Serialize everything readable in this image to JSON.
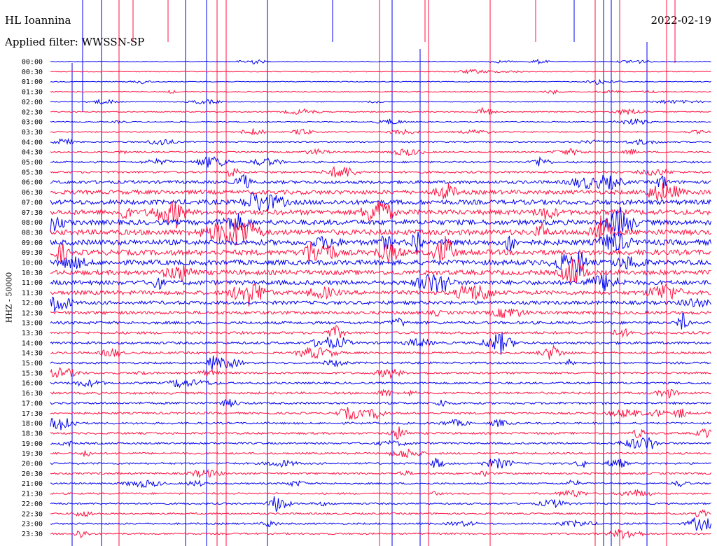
{
  "header": {
    "station": "HL Ioannina",
    "filter": "Applied filter: WWSSN-SP",
    "date": "2022-02-19"
  },
  "colors": {
    "trace_a": "#0000ee",
    "trace_b": "#ff1040"
  },
  "chart_data": {
    "type": "line",
    "title": "HL Ioannina",
    "subtitle": "Applied filter: WWSSN-SP",
    "ylabel": "HHZ - 50000",
    "y_ticks": [
      "00:00",
      "00:30",
      "01:00",
      "01:30",
      "02:00",
      "02:30",
      "03:00",
      "03:30",
      "04:00",
      "04:30",
      "05:00",
      "05:30",
      "06:00",
      "06:30",
      "07:00",
      "07:30",
      "08:00",
      "08:30",
      "09:00",
      "09:30",
      "10:00",
      "10:30",
      "11:00",
      "11:30",
      "12:00",
      "12:30",
      "13:00",
      "13:30",
      "14:00",
      "14:30",
      "15:00",
      "15:30",
      "16:00",
      "16:30",
      "17:00",
      "17:30",
      "18:00",
      "18:30",
      "19:00",
      "19:30",
      "20:00",
      "20:30",
      "21:00",
      "21:30",
      "22:00",
      "22:30",
      "23:00",
      "23:30"
    ],
    "row_activity": [
      0.25,
      0.25,
      0.25,
      0.3,
      0.25,
      0.35,
      0.35,
      0.4,
      0.4,
      0.45,
      0.6,
      0.7,
      1.0,
      1.3,
      1.5,
      1.6,
      1.6,
      1.7,
      1.7,
      1.7,
      1.6,
      1.5,
      1.4,
      1.3,
      1.1,
      1.0,
      0.9,
      0.8,
      0.8,
      0.7,
      0.65,
      0.65,
      0.65,
      0.7,
      0.7,
      0.65,
      0.65,
      0.65,
      0.6,
      0.6,
      0.6,
      0.6,
      0.55,
      0.55,
      0.55,
      0.55,
      0.55,
      0.55
    ],
    "grid": false
  }
}
